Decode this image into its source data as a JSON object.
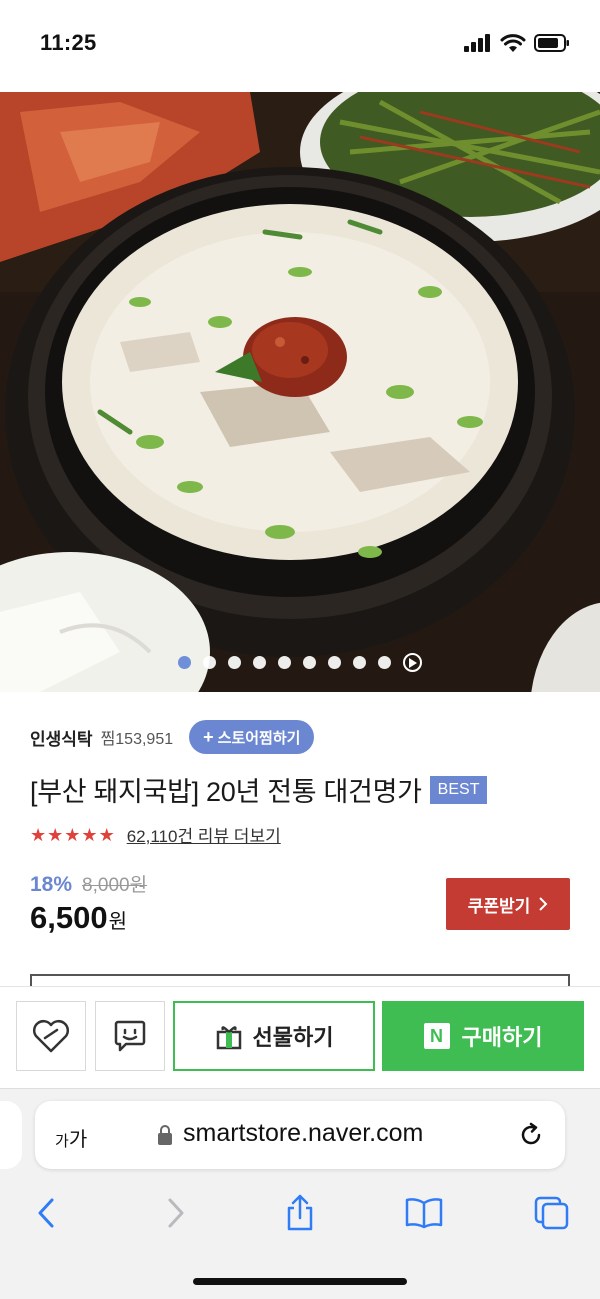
{
  "status_bar": {
    "time": "11:25",
    "icons": [
      "cellular-signal-icon",
      "wifi-icon",
      "battery-icon"
    ]
  },
  "hero": {
    "image_alt": "돼지국밥",
    "slide_count": 9,
    "active_slide": 1,
    "has_play_control": true
  },
  "product": {
    "store_name": "인생식탁",
    "like_label": "찜153,951",
    "store_like_button": "스토어찜하기",
    "title": "[부산 돼지국밥] 20년 전통 대건명가",
    "badge": "BEST",
    "star_rating": 5,
    "review_link": "62,110건 리뷰 더보기",
    "discount_rate": "18%",
    "original_price": "8,000원",
    "price": "6,500",
    "price_unit": "원",
    "coupon_button": "쿠폰받기"
  },
  "action_bar": {
    "like_icon": "heart-icon",
    "talk_icon": "talk-bubble-icon",
    "gift_button": "선물하기",
    "buy_button_logo": "N",
    "buy_button": "구매하기"
  },
  "browser": {
    "text_size_label_small": "가",
    "text_size_label_large": "가",
    "url": "smartstore.naver.com"
  },
  "colors": {
    "accent_blue": "#6c87d2",
    "coupon_red": "#c43b33",
    "naver_green": "#3fbc52",
    "star_red": "#e0413a",
    "ios_blue": "#2f7cf6"
  }
}
